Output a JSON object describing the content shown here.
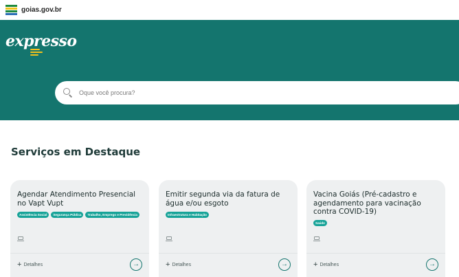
{
  "topbar": {
    "site": "goias.gov.br"
  },
  "hero": {
    "brand": "expresso",
    "search_placeholder": "Oque você procura?"
  },
  "section": {
    "title": "Serviços em Destaque"
  },
  "cards": [
    {
      "title": "Agendar Atendimento Presencial no Vapt Vupt",
      "tags": [
        "Assistência Social",
        "Segurança Pública",
        "Trabalho, Emprego e Previdência"
      ],
      "details_label": "Detalhes",
      "arrow": "→"
    },
    {
      "title": "Emitir segunda via da fatura de água e/ou esgoto",
      "tags": [
        "Infraestrutura e Habitação"
      ],
      "details_label": "Detalhes",
      "arrow": "→"
    },
    {
      "title": "Vacina Goiás (Pré-cadastro e agendamento para vacinação contra COVID-19)",
      "tags": [
        "Saúde"
      ],
      "details_label": "Detalhes",
      "arrow": "→"
    }
  ],
  "colors": {
    "primary": "#14756e",
    "tag": "#17a398",
    "accent": "#f4c21b"
  }
}
